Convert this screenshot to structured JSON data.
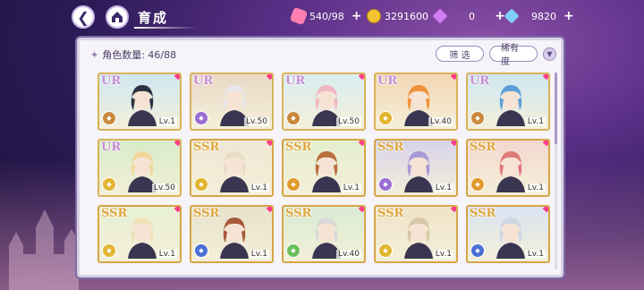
{
  "header": {
    "title": "育成",
    "resources": [
      {
        "name": "candy-icon",
        "value": "540/98",
        "color": "#ff7fb0"
      },
      {
        "name": "gold-coin-icon",
        "value": "3291600",
        "color": "#f1c232"
      },
      {
        "name": "pink-gem-icon",
        "value": "0",
        "color": "#d47bf0"
      },
      {
        "name": "blue-gem-icon",
        "value": "9820",
        "color": "#7fd0f5"
      }
    ]
  },
  "panel": {
    "count_label": "角色数量: 46/88",
    "filter_label": "筛 选",
    "rarity_label": "稀有度"
  },
  "cards": [
    {
      "rarity": "UR",
      "level": "Lv.1",
      "elem_color": "#c98a3d",
      "hair": "#2b3344",
      "bg": "#cfe7f3"
    },
    {
      "rarity": "UR",
      "level": "Lv.50",
      "elem_color": "#9b6fd3",
      "hair": "#e8e6ea",
      "bg": "#e9d9c7"
    },
    {
      "rarity": "UR",
      "level": "Lv.50",
      "elem_color": "#c98a3d",
      "hair": "#f0b7c6",
      "bg": "#d9eef0"
    },
    {
      "rarity": "UR",
      "level": "Lv.40",
      "elem_color": "#e2b532",
      "hair": "#f0923a",
      "bg": "#f3d6b3"
    },
    {
      "rarity": "UR",
      "level": "Lv.1",
      "elem_color": "#c98a3d",
      "hair": "#5c9fd6",
      "bg": "#cfe7f3"
    },
    {
      "rarity": "UR",
      "level": "Lv.50",
      "elem_color": "#e2b532",
      "hair": "#f2d79b",
      "bg": "#d7ecc8"
    },
    {
      "rarity": "SSR",
      "level": "Lv.1",
      "elem_color": "#e2b532",
      "hair": "#e8dcc6",
      "bg": "#efe7d3"
    },
    {
      "rarity": "SSR",
      "level": "Lv.1",
      "elem_color": "#e29a2e",
      "hair": "#b8703d",
      "bg": "#e4efcf"
    },
    {
      "rarity": "SSR",
      "level": "Lv.1",
      "elem_color": "#9b6fd3",
      "hair": "#a89ad8",
      "bg": "#d7d3ea"
    },
    {
      "rarity": "SSR",
      "level": "Lv.1",
      "elem_color": "#e29a2e",
      "hair": "#e07b7b",
      "bg": "#f3d7cf"
    },
    {
      "rarity": "SSR",
      "level": "Lv.1",
      "elem_color": "#e2b532",
      "hair": "#efe2b8",
      "bg": "#e7f0d3"
    },
    {
      "rarity": "SSR",
      "level": "Lv.1",
      "elem_color": "#4b6fd6",
      "hair": "#a95a3b",
      "bg": "#e6e2cc"
    },
    {
      "rarity": "SSR",
      "level": "Lv.40",
      "elem_color": "#6dbf5a",
      "hair": "#d9d9d9",
      "bg": "#d9ecd3"
    },
    {
      "rarity": "SSR",
      "level": "Lv.1",
      "elem_color": "#e2b532",
      "hair": "#d8c8a6",
      "bg": "#efe3c8"
    },
    {
      "rarity": "SSR",
      "level": "Lv.1",
      "elem_color": "#4b6fd6",
      "hair": "#cfd6e3",
      "bg": "#d9e3f1"
    }
  ]
}
